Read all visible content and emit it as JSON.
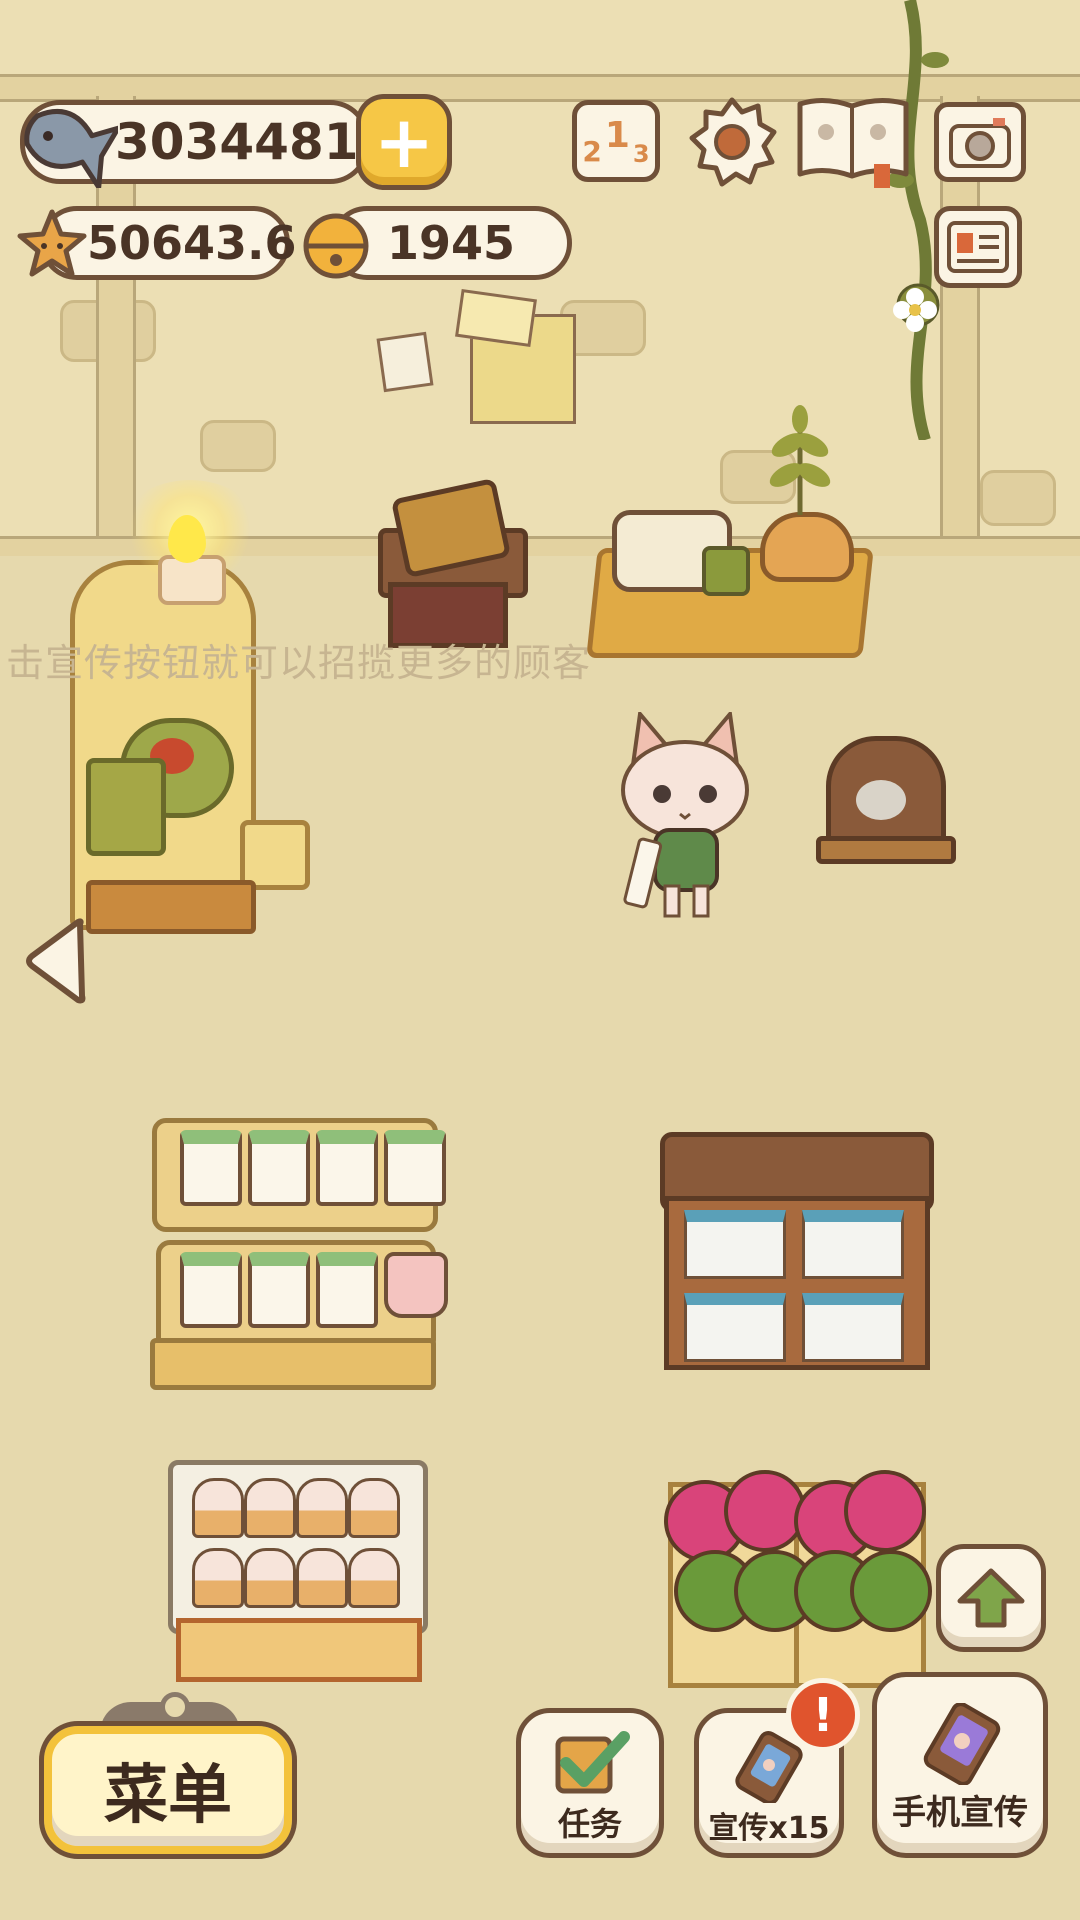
{
  "hud": {
    "fish_coins": "3034481",
    "stars": "50643.6",
    "bells": "1945"
  },
  "icons": {
    "fish": "fish-icon",
    "plus": "plus-icon",
    "ranking": "ranking-podium-icon",
    "settings": "gear-icon",
    "book": "paw-book-icon",
    "camera": "camera-icon",
    "profile_card": "profile-card-icon",
    "star": "star-icon",
    "bell": "bell-icon",
    "back_arrow": "left-arrow-icon",
    "upgrade": "up-arrow-icon",
    "alert": "exclamation-icon"
  },
  "ranking_digits": [
    "2",
    "1",
    "3"
  ],
  "hint_text": "击宣传按钮就可以招揽更多的顾客",
  "bottom": {
    "menu_label": "菜单",
    "tasks_label": "任务",
    "promote_label": "宣传x15",
    "phone_promote_label": "手机宣传",
    "alert_mark": "!"
  },
  "colors": {
    "outline": "#6f5038",
    "accent_yellow": "#f6c746",
    "alert_red": "#e0542d",
    "check_green": "#5aa064"
  }
}
